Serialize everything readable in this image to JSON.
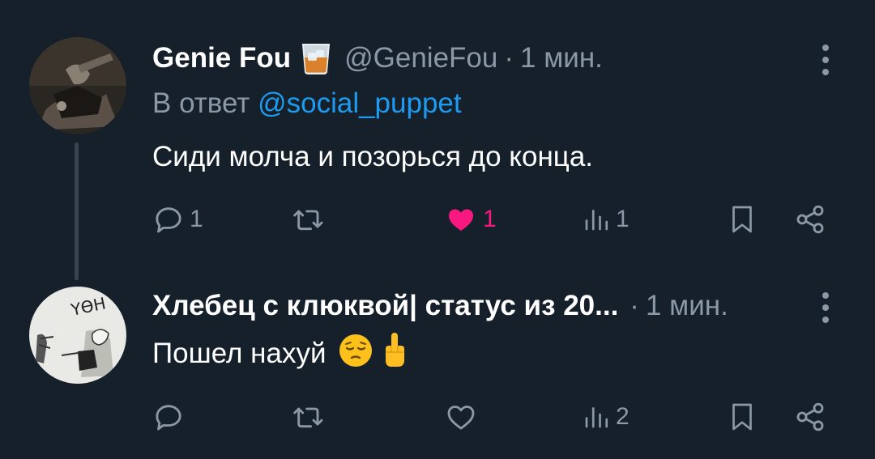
{
  "tweets": [
    {
      "display_name": "Genie Fou",
      "badge_icon": "whiskey-glass-icon",
      "handle": "@GenieFou",
      "separator": "·",
      "time": "1 мин.",
      "reply_prefix": "В ответ",
      "reply_mention": "@social_puppet",
      "text": "Сиди молча и позорься до конца.",
      "text_emojis": [],
      "actions": {
        "replies": "1",
        "retweets": "",
        "likes": "1",
        "liked": true,
        "views": "1"
      }
    },
    {
      "display_name": "Хлебец с клюквой| статус из 20...",
      "handle": "",
      "separator": "·",
      "time": "1 мин.",
      "text": "Пошел нахуй",
      "text_emojis": [
        "pensive-face-emoji",
        "middle-finger-emoji"
      ],
      "actions": {
        "replies": "",
        "retweets": "",
        "likes": "",
        "liked": false,
        "views": "2"
      }
    }
  ],
  "avatar_text": "ҮӨН",
  "colors": {
    "background": "#15202b",
    "muted": "#8b98a5",
    "accent": "#1d9bf0",
    "like": "#f91880",
    "thread_line": "#38444d"
  }
}
